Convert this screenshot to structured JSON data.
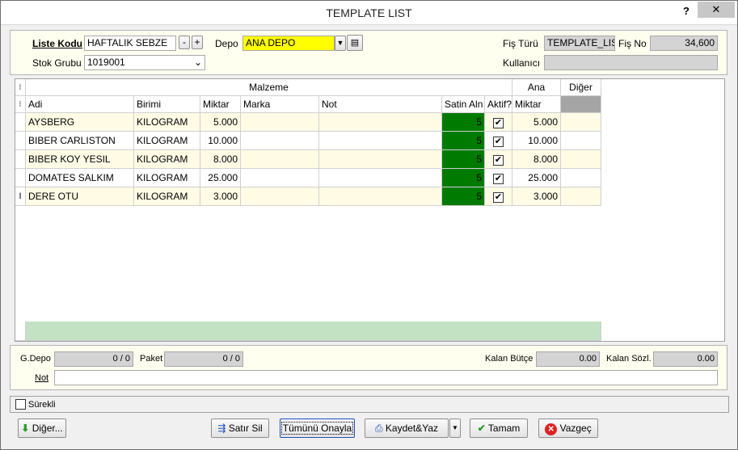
{
  "window": {
    "title": "TEMPLATE LIST",
    "help_label": "?",
    "close_label": "✕"
  },
  "header": {
    "liste_kodu_label": "Liste Kodu",
    "liste_kodu_value": "HAFTALIK SEBZE",
    "minus": "-",
    "plus": "+",
    "stok_grubu_label": "Stok Grubu",
    "stok_grubu_value": "1019001",
    "depo_label": "Depo",
    "depo_value": "ANA DEPO",
    "fis_turu_label": "Fiş Türü",
    "fis_turu_value": "TEMPLATE_LIS",
    "fis_no_label": "Fiş No",
    "fis_no_value": "34,600",
    "kullanici_label": "Kullanıcı",
    "kullanici_value": ""
  },
  "grid": {
    "group_headers": {
      "malzeme": "Malzeme",
      "ana": "Ana",
      "diger": "Diğer"
    },
    "columns": [
      "Adi",
      "Birimi",
      "Miktar",
      "Marka",
      "Not",
      "Satin Aln",
      "Aktif?",
      "Miktar"
    ],
    "rows": [
      {
        "adi": "AYSBERG",
        "birimi": "KILOGRAM",
        "miktar": "5.000",
        "marka": "",
        "not": "",
        "satin": "5",
        "aktif": true,
        "ana_miktar": "5.000"
      },
      {
        "adi": "BIBER CARLISTON",
        "birimi": "KILOGRAM",
        "miktar": "10.000",
        "marka": "",
        "not": "",
        "satin": "5",
        "aktif": true,
        "ana_miktar": "10.000"
      },
      {
        "adi": "BIBER KOY YESIL",
        "birimi": "KILOGRAM",
        "miktar": "8.000",
        "marka": "",
        "not": "",
        "satin": "5",
        "aktif": true,
        "ana_miktar": "8.000"
      },
      {
        "adi": "DOMATES SALKIM",
        "birimi": "KILOGRAM",
        "miktar": "25.000",
        "marka": "",
        "not": "",
        "satin": "5",
        "aktif": true,
        "ana_miktar": "25.000"
      },
      {
        "adi": "DERE OTU",
        "birimi": "KILOGRAM",
        "miktar": "3.000",
        "marka": "",
        "not": "",
        "satin": "5",
        "aktif": true,
        "ana_miktar": "3.000"
      }
    ],
    "row_indicator": "I",
    "colors": {
      "row_odd": "#fffbe5",
      "row_even": "#ffffff",
      "satin_bg": "#007a00",
      "footer": "#c3e2c3",
      "diger_header": "#a5a5a5"
    }
  },
  "footer": {
    "gdepo_label": "G.Depo",
    "gdepo_value": "0 / 0",
    "paket_label": "Paket",
    "paket_value": "0 / 0",
    "kalan_butce_label": "Kalan Bütçe",
    "kalan_butce_value": "0.00",
    "kalan_sozl_label": "Kalan Sözl.",
    "kalan_sozl_value": "0.00",
    "not_label": "Not",
    "not_value": ""
  },
  "surekli_label": "Sürekli",
  "buttons": {
    "diger": "Diğer...",
    "satir_sil": "Satır Sil",
    "tumunu_onayla": "Tümünü Onayla",
    "kaydet_yaz": "Kaydet&Yaz",
    "tamam": "Tamam",
    "vazgec": "Vazgeç"
  }
}
